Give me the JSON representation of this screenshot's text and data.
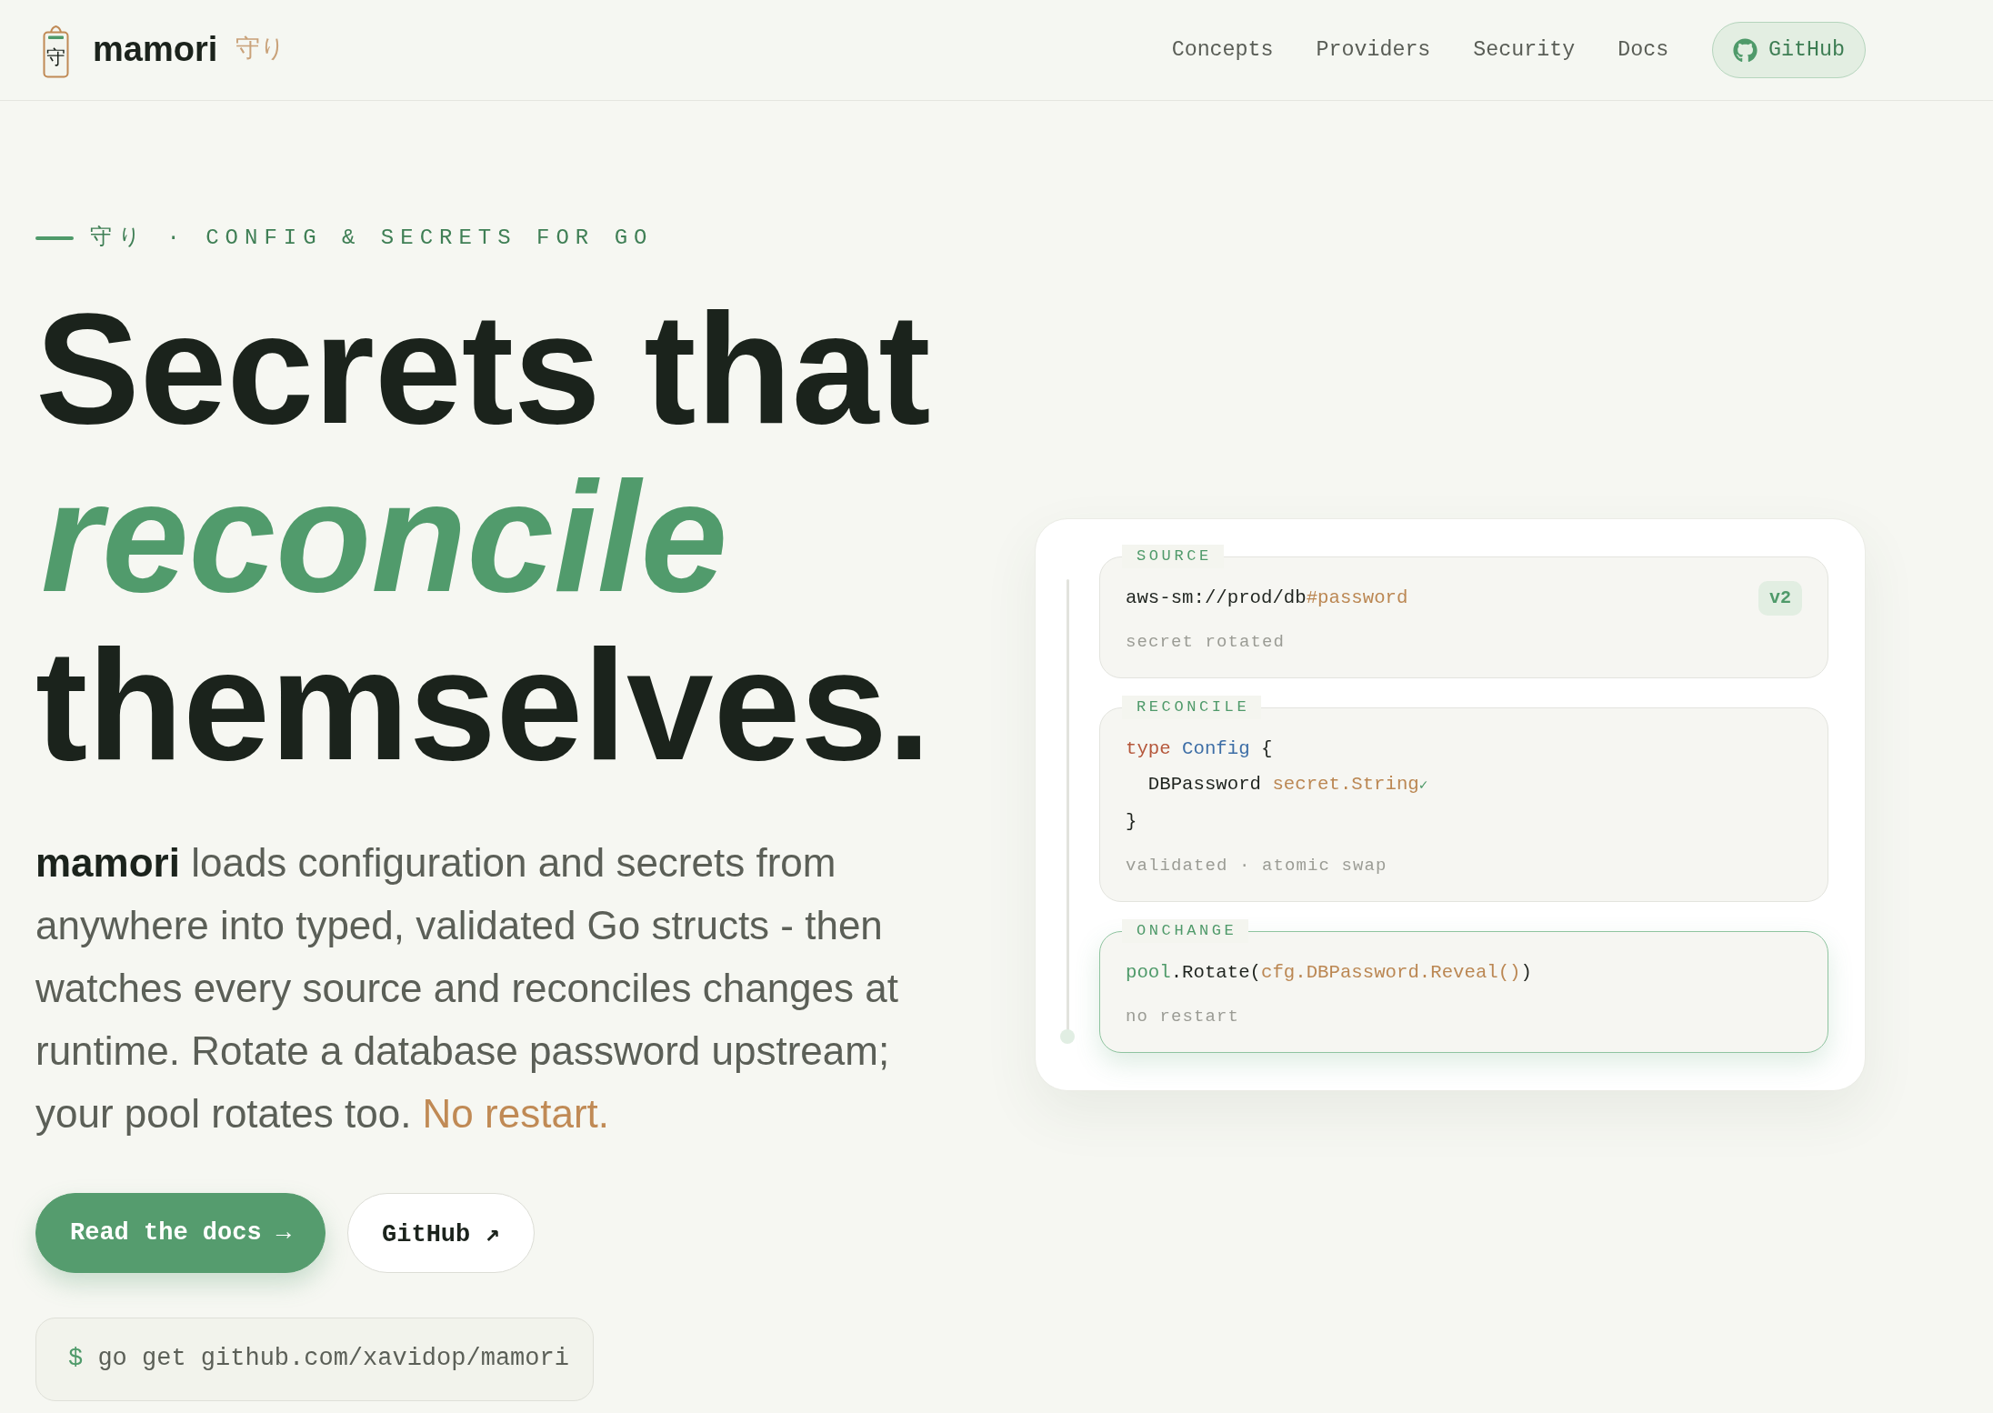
{
  "header": {
    "logo": {
      "glyph": "守"
    },
    "brand": "mamori",
    "brand_kana": "守り",
    "nav": [
      {
        "label": "Concepts"
      },
      {
        "label": "Providers"
      },
      {
        "label": "Security"
      },
      {
        "label": "Docs"
      }
    ],
    "github_button": {
      "label": "GitHub"
    }
  },
  "hero": {
    "eyebrow": "守り · CONFIG & SECRETS FOR GO",
    "heading": [
      {
        "text": "Secrets that",
        "kind": "plain"
      },
      {
        "text": "reconcile",
        "kind": "accent"
      },
      {
        "text": "themselves.",
        "kind": "plain"
      }
    ],
    "intro": {
      "text": "**mamori** loads configuration and secrets from anywhere into typed, validated Go structs - then watches every source and reconciles changes at runtime. Rotate a database password upstream; your pool rotates too.",
      "highlight": "No restart."
    },
    "buttons": [
      {
        "label": "Read the docs →",
        "kind": "primary"
      },
      {
        "label": "GitHub ↗",
        "kind": "secondary"
      }
    ],
    "install": {
      "prompt": "$",
      "command": "go get github.com/xavidop/mamori"
    }
  },
  "pipeline": {
    "stages": [
      {
        "label": "SOURCE",
        "active": false,
        "badge": "v2",
        "code": [
          {
            "tokens": [
              {
                "text": "aws-sm://prod/db",
                "kind": "plain"
              },
              {
                "text": "#password",
                "kind": "string"
              }
            ]
          }
        ],
        "note": "secret rotated"
      },
      {
        "label": "RECONCILE",
        "active": false,
        "code": [
          {
            "tokens": [
              {
                "text": "type ",
                "kind": "keyword"
              },
              {
                "text": "Config",
                "kind": "type"
              },
              {
                "text": " {",
                "kind": "plain"
              }
            ]
          },
          {
            "tokens": [
              {
                "text": "  DBPassword ",
                "kind": "plain"
              },
              {
                "text": "secret.String",
                "kind": "string"
              },
              {
                "text": "✓",
                "kind": "check"
              }
            ]
          },
          {
            "tokens": [
              {
                "text": "}",
                "kind": "plain"
              }
            ]
          }
        ],
        "note": "validated · atomic swap"
      },
      {
        "label": "ONCHANGE",
        "active": true,
        "code": [
          {
            "tokens": [
              {
                "text": "pool",
                "kind": "ident"
              },
              {
                "text": ".Rotate(",
                "kind": "plain"
              },
              {
                "text": "cfg.DBPassword.Reveal()",
                "kind": "string"
              },
              {
                "text": ")",
                "kind": "plain"
              }
            ]
          }
        ],
        "note": "no restart"
      }
    ]
  }
}
